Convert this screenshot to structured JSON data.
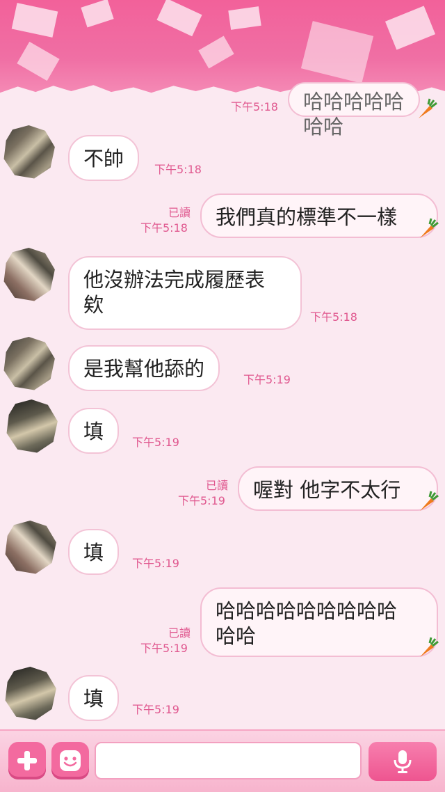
{
  "colors": {
    "accent": "#f2619a",
    "bubble_border": "#f3c3d6",
    "time_color": "#e0588f"
  },
  "messages": [
    {
      "side": "out",
      "text": "哈哈哈哈哈哈哈",
      "time": "下午5:18",
      "read": ""
    },
    {
      "side": "in",
      "text": "不帥",
      "time": "下午5:18"
    },
    {
      "side": "out",
      "text": "我們真的標準不一樣",
      "time": "下午5:18",
      "read": "已讀"
    },
    {
      "side": "in",
      "text": "他沒辦法完成履歷表\n欸",
      "time": "下午5:18"
    },
    {
      "side": "in",
      "text": "是我幫他舔的",
      "time": "下午5:19"
    },
    {
      "side": "in",
      "text": "填",
      "time": "下午5:19"
    },
    {
      "side": "out",
      "text": "喔對 他字不太行",
      "time": "下午5:19",
      "read": "已讀"
    },
    {
      "side": "in",
      "text": "填",
      "time": "下午5:19"
    },
    {
      "side": "out",
      "text": "哈哈哈哈哈哈哈哈哈\n哈哈",
      "time": "下午5:19",
      "read": "已讀"
    },
    {
      "side": "in",
      "text": "填",
      "time": "下午5:19"
    }
  ],
  "input": {
    "value": "",
    "placeholder": ""
  },
  "icons": {
    "add": "plus-icon",
    "emoji": "smiley-icon",
    "mic": "microphone-icon",
    "sticker": "carrot-icon"
  }
}
